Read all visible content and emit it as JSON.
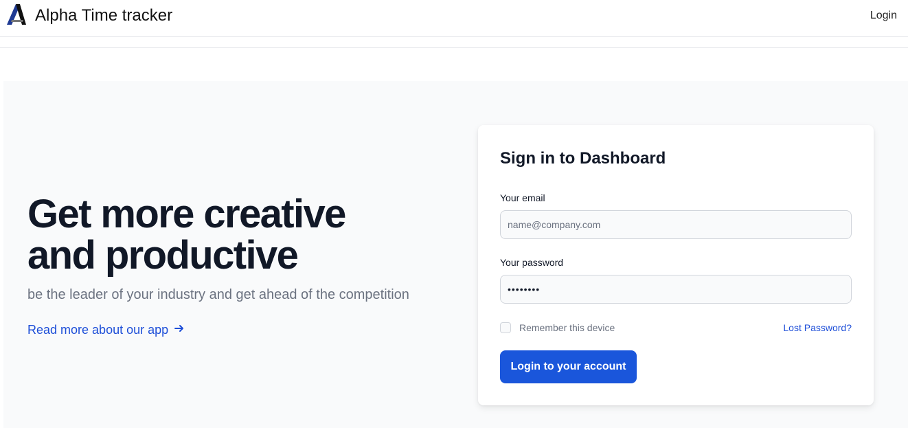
{
  "header": {
    "brand_name": "Alpha Time tracker",
    "logo_icon": "alpha-triangle-logo",
    "nav_login": "Login"
  },
  "hero": {
    "headline_line1": "Get more creative",
    "headline_line2": "and productive",
    "subheadline": "be the leader of your industry and get ahead of the competition",
    "read_more_label": "Read more about our app",
    "read_more_icon": "arrow-right-icon"
  },
  "signin": {
    "title": "Sign in to Dashboard",
    "email_label": "Your email",
    "email_placeholder": "name@company.com",
    "email_value": "",
    "password_label": "Your password",
    "password_value": "••••••••",
    "remember_label": "Remember this device",
    "remember_checked": false,
    "lost_password_label": "Lost Password?",
    "submit_label": "Login to your account"
  },
  "colors": {
    "accent": "#1a56db",
    "link": "#1d4ed8",
    "hero_background": "#f9fafb",
    "heading": "#111827",
    "muted_text": "#6b7280"
  }
}
